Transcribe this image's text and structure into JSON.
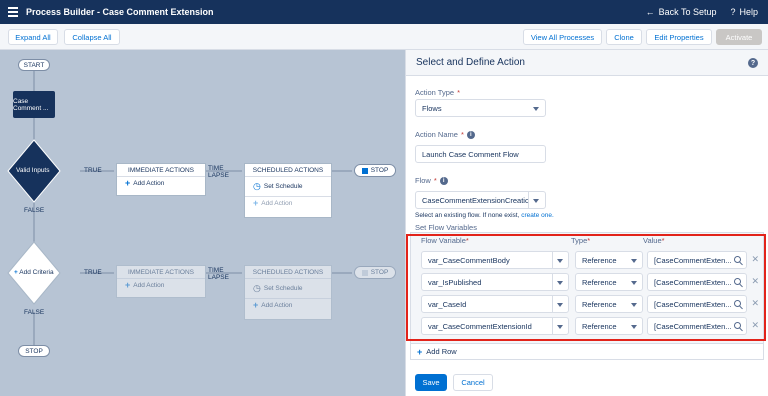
{
  "app": {
    "title": "Process Builder - Case Comment Extension",
    "back_label": "Back To Setup",
    "help_label": "Help"
  },
  "toolbar": {
    "expand_all": "Expand All",
    "collapse_all": "Collapse All",
    "view_all_processes": "View All Processes",
    "clone": "Clone",
    "edit_properties": "Edit Properties",
    "activate": "Activate"
  },
  "canvas": {
    "start": "START",
    "object_node": "Case Comment ...",
    "criteria1": "Valid Inputs",
    "true1": "TRUE",
    "false1": "FALSE",
    "immediate1_title": "IMMEDIATE ACTIONS",
    "immediate1_add": "Add Action",
    "time_lapse1": "TIME LAPSE",
    "scheduled1_title": "SCHEDULED ACTIONS",
    "scheduled1_set": "Set Schedule",
    "scheduled1_add": "Add Action",
    "stop1": "STOP",
    "criteria2": "Add Criteria",
    "true2": "TRUE",
    "false2": "FALSE",
    "immediate2_title": "IMMEDIATE ACTIONS",
    "immediate2_add": "Add Action",
    "time_lapse2": "TIME LAPSE",
    "scheduled2_title": "SCHEDULED ACTIONS",
    "scheduled2_set": "Set Schedule",
    "scheduled2_add": "Add Action",
    "stop2": "STOP",
    "stop_end": "STOP"
  },
  "panel": {
    "title": "Select and Define Action",
    "action_type_label": "Action Type",
    "action_type_value": "Flows",
    "action_name_label": "Action Name",
    "action_name_value": "Launch Case Comment Flow",
    "flow_label": "Flow",
    "flow_value": "CaseCommentExtensionCreatio",
    "flow_hint": "Select an existing flow. If none exist,",
    "flow_hint_link": "create one.",
    "set_vars_label": "Set Flow Variables",
    "col_variable": "Flow Variable",
    "col_type": "Type",
    "col_value": "Value",
    "rows": [
      {
        "variable": "var_CaseCommentBody",
        "type": "Reference",
        "value": "[CaseCommentExten..."
      },
      {
        "variable": "var_IsPublished",
        "type": "Reference",
        "value": "[CaseCommentExten..."
      },
      {
        "variable": "var_CaseId",
        "type": "Reference",
        "value": "[CaseCommentExten..."
      },
      {
        "variable": "var_CaseCommentExtensionId",
        "type": "Reference",
        "value": "[CaseCommentExten..."
      }
    ],
    "add_row": "Add Row",
    "save": "Save",
    "cancel": "Cancel"
  },
  "colors": {
    "header": "#16325c",
    "accent": "#0070d2",
    "highlight": "#e2231a",
    "canvas": "#b7c4d4"
  }
}
